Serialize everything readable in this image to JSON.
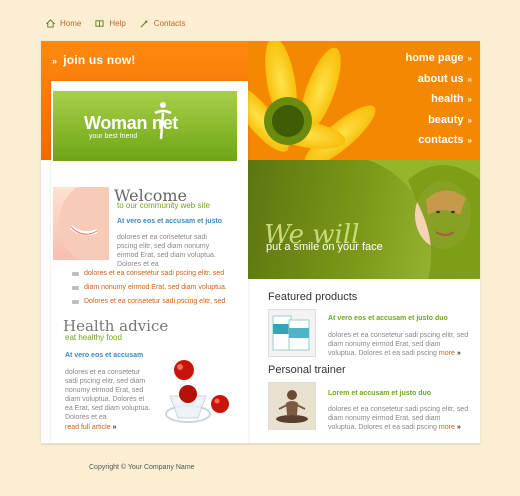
{
  "topnav": {
    "items": [
      {
        "label": "Home",
        "icon": "home-icon"
      },
      {
        "label": "Help",
        "icon": "book-icon"
      },
      {
        "label": "Contacts",
        "icon": "pen-icon"
      }
    ]
  },
  "header": {
    "join_label": "join us now!",
    "nav": [
      "home page",
      "about us",
      "health",
      "beauty",
      "contacts"
    ]
  },
  "logo": {
    "text": "Woman net",
    "tagline": "your best friend"
  },
  "banner": {
    "title": "We will",
    "subtitle": "put a smile on your face"
  },
  "welcome": {
    "title": "Welcome",
    "subtitle": "to our community web site",
    "heading": "At vero eos et accusam et justo",
    "text": "dolores et ea consetetur sadi pscing elitr, sed diam nonumy eirmod Erat, sed diam voluptua. Dolores et ea",
    "bullets": [
      "dolores et ea consetetur sadi pscing elitr, sed",
      "diam nonumy eirmod Erat, sed diam voluptua.",
      "Dolores et ea consetetur sadi pscing elitr, sed"
    ]
  },
  "health": {
    "title": "Health advice",
    "subtitle": "eat healthy food",
    "heading": "At vero eos et accusam",
    "text": "dolores et ea consetetur sadi pscing elitr, sed diam nonumy eirmod Erat, sed diam voluptua. Dolores et ea Erat, sed diam voluptua. Dolores et ea",
    "read_more": "read full article"
  },
  "featured": {
    "title": "Featured products",
    "heading": "At vero eos et accusam et justo duo",
    "text": "dolores et ea consetetur sadi pscing elitr, sed diam nonumy eirmod Erat, sed diam voluptua. Dolores et ea sadi pscing",
    "more": "more"
  },
  "trainer": {
    "title": "Personal trainer",
    "heading": "Lorem et accusam et justo duo",
    "text": "dolores et ea consetetur sadi pscing elitr, sed diam nonumy eirmod Erat, sed diam voluptua. Dolores et ea sadi pscing",
    "more": "more"
  },
  "footer": {
    "copyright": "Copyright © Your Company Name"
  },
  "colors": {
    "background": "#fbeed2",
    "orange": "#f47a00",
    "green": "#72a51d",
    "link": "#d15f14"
  }
}
